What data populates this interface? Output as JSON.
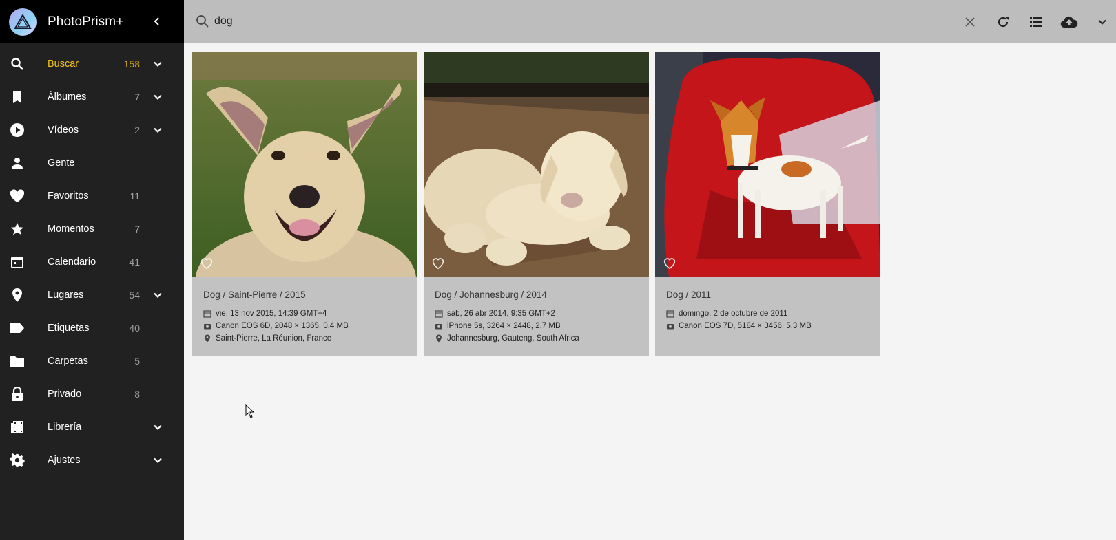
{
  "app": {
    "name": "PhotoPrism+"
  },
  "colors": {
    "sidebar_bg": "#212121",
    "brand_bg": "#000000",
    "active": "#f4c41b",
    "toolbar_bg": "#bdbdbd",
    "card_bg": "#c2c2c2",
    "page_bg": "#f4f4f4"
  },
  "search": {
    "value": "dog",
    "placeholder": "Buscar"
  },
  "sidebar": {
    "items": [
      {
        "label": "Buscar",
        "count": "158",
        "icon": "search-icon",
        "active": true,
        "chevron": true
      },
      {
        "label": "Álbumes",
        "count": "7",
        "icon": "bookmark-icon",
        "chevron": true
      },
      {
        "label": "Vídeos",
        "count": "2",
        "icon": "play-circle-icon",
        "chevron": true
      },
      {
        "label": "Gente",
        "count": "",
        "icon": "person-icon"
      },
      {
        "label": "Favoritos",
        "count": "11",
        "icon": "heart-icon"
      },
      {
        "label": "Momentos",
        "count": "7",
        "icon": "star-icon"
      },
      {
        "label": "Calendario",
        "count": "41",
        "icon": "calendar-icon"
      },
      {
        "label": "Lugares",
        "count": "54",
        "icon": "place-icon",
        "chevron": true
      },
      {
        "label": "Etiquetas",
        "count": "40",
        "icon": "label-icon"
      },
      {
        "label": "Carpetas",
        "count": "5",
        "icon": "folder-icon"
      },
      {
        "label": "Privado",
        "count": "8",
        "icon": "lock-icon"
      },
      {
        "label": "Librería",
        "count": "",
        "icon": "film-icon",
        "chevron": true
      },
      {
        "label": "Ajustes",
        "count": "",
        "icon": "gear-icon",
        "chevron": true
      }
    ]
  },
  "toolbar": {
    "icons": [
      "close-icon",
      "refresh-icon",
      "view-list-icon",
      "cloud-upload-icon",
      "chevron-down-icon"
    ]
  },
  "photos": [
    {
      "title": "Dog / Saint-Pierre / 2015",
      "date": "vie, 13 nov 2015, 14:39 GMT+4",
      "camera": "Canon EOS 6D, 2048 × 1365, 0.4 MB",
      "location": "Saint-Pierre, La Réunion, France"
    },
    {
      "title": "Dog / Johannesburg / 2014",
      "date": "sáb, 26 abr 2014, 9:35 GMT+2",
      "camera": "iPhone 5s, 3264 × 2448, 2.7 MB",
      "location": "Johannesburg, Gauteng, South Africa"
    },
    {
      "title": "Dog / 2011",
      "date": "domingo, 2 de octubre de 2011",
      "camera": "Canon EOS 7D, 5184 × 3456, 5.3 MB"
    }
  ]
}
